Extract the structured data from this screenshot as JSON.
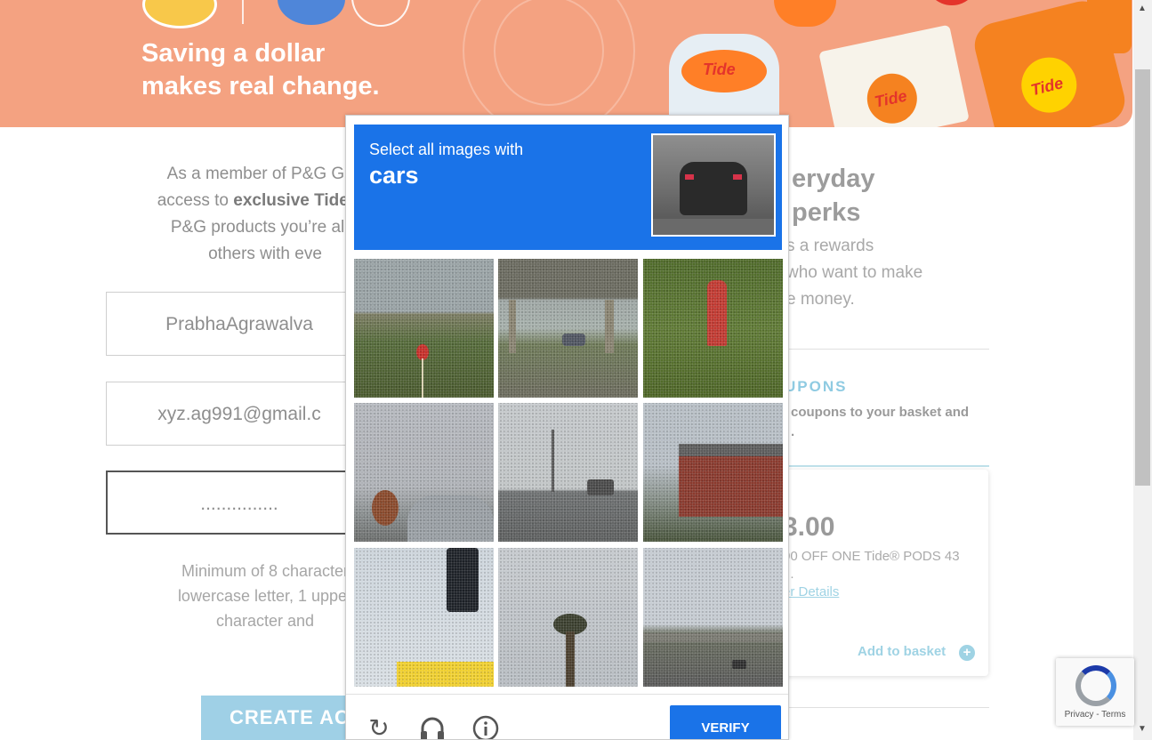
{
  "hero": {
    "line1": "Saving a dollar",
    "line2": "makes real change.",
    "product_brand": "Tide"
  },
  "intro": {
    "line1": "As a member of P&G Goo",
    "line2_prefix": "access to ",
    "line2_bold": "exclusive Tide co",
    "line3": "P&G products you’re alre",
    "line4": "others with eve"
  },
  "form": {
    "username": "PrabhaAgrawalva",
    "email": "xyz.ag991@gmail.c",
    "password": "...............",
    "hint_line1": "Minimum of 8 character",
    "hint_line2": "lowercase letter, 1 upper",
    "hint_line3": "character and",
    "create_button": "CREATE AC"
  },
  "right": {
    "head_line1": "eryday",
    "head_line2": "perks",
    "sub_line1": "s a rewards",
    "sub_line2": "who want to make",
    "sub_line3": "e money.",
    "coupons_title": "UPONS",
    "coupons_desc_line1": "coupons to your basket and",
    "coupons_desc_line2": ".",
    "price": "3.00",
    "offer_line1": "00 OFF ONE Tide® PODS 43",
    "offer_line2": "...",
    "offer_link": "er Details",
    "add_basket": "Add to basket",
    "add_plus": "+"
  },
  "recaptcha_badge": {
    "links": "Privacy - Terms"
  },
  "challenge": {
    "instruction": "Select all images with",
    "target": "cars",
    "tiles": [
      {
        "content": "hillside with red sign"
      },
      {
        "content": "overpass with cars"
      },
      {
        "content": "red fire hydrant"
      },
      {
        "content": "cloudy road"
      },
      {
        "content": "street with truck"
      },
      {
        "content": "brick building"
      },
      {
        "content": "traffic light"
      },
      {
        "content": "palm tree"
      },
      {
        "content": "highway bridge"
      }
    ],
    "verify_label": "VERIFY",
    "icons": [
      "reload-icon",
      "audio-icon",
      "info-icon"
    ]
  },
  "colors": {
    "accent_blue": "#1a73e8",
    "hero_orange": "#f4a281",
    "light_teal": "#9fd3e4"
  }
}
